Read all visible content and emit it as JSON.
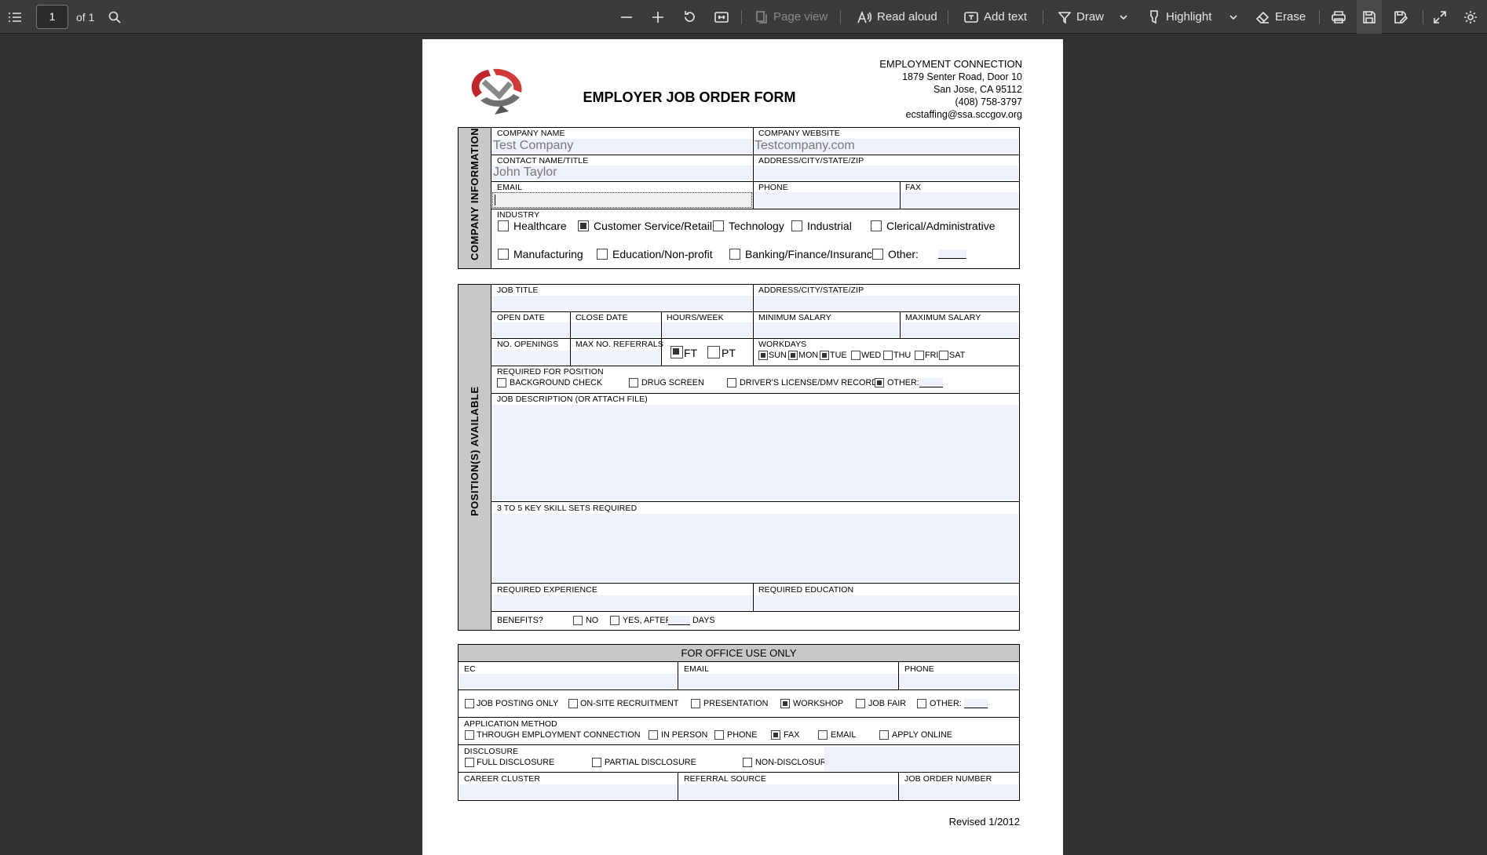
{
  "toolbar": {
    "page_current": "1",
    "page_total": "of 1",
    "page_view": "Page view",
    "read_aloud": "Read aloud",
    "add_text": "Add text",
    "draw": "Draw",
    "highlight": "Highlight",
    "erase": "Erase"
  },
  "form": {
    "org_name": "EMPLOYMENT CONNECTION",
    "org_address": "1879 Senter Road, Door 10",
    "org_city": "San Jose, CA 95112",
    "org_phone": "(408) 758-3797",
    "org_email": "ecstaffing@ssa.sccgov.org",
    "title": "EMPLOYER JOB ORDER FORM",
    "company_section": "COMPANY INFORMATION",
    "company_name_label": "COMPANY NAME",
    "company_name_value": "Test Company",
    "company_website_label": "COMPANY WEBSITE",
    "company_website_value": "Testcompany.com",
    "contact_label": "CONTACT NAME/TITLE",
    "contact_value": "John Taylor",
    "address_label": "ADDRESS/CITY/STATE/ZIP",
    "email_label": "EMAIL",
    "phone_label": "PHONE",
    "fax_label": "FAX",
    "industry_label": "INDUSTRY",
    "industry": [
      {
        "label": "Healthcare",
        "checked": false
      },
      {
        "label": "Customer Service/Retail",
        "checked": true
      },
      {
        "label": "Technology",
        "checked": false
      },
      {
        "label": "Industrial",
        "checked": false
      },
      {
        "label": "Clerical/Administrative",
        "checked": false
      },
      {
        "label": "Manufacturing",
        "checked": false
      },
      {
        "label": "Education/Non-profit",
        "checked": false
      },
      {
        "label": "Banking/Finance/Insurance",
        "checked": false
      },
      {
        "label": "Other:",
        "checked": false
      }
    ],
    "positions_section": "POSITION(S) AVAILABLE",
    "job_title_label": "JOB TITLE",
    "job_address_label": "ADDRESS/CITY/STATE/ZIP",
    "open_date_label": "OPEN DATE",
    "close_date_label": "CLOSE DATE",
    "hours_label": "HOURS/WEEK",
    "min_salary_label": "MINIMUM SALARY",
    "max_salary_label": "MAXIMUM SALARY",
    "openings_label": "NO. OPENINGS",
    "max_referrals_label": "MAX NO. REFERRALS",
    "ft": {
      "label": "FT",
      "checked": true
    },
    "pt": {
      "label": "PT",
      "checked": false
    },
    "workdays_label": "WORKDAYS",
    "workdays": [
      {
        "label": "SUN",
        "checked": true
      },
      {
        "label": "MON",
        "checked": true
      },
      {
        "label": "TUE",
        "checked": true
      },
      {
        "label": "WED",
        "checked": false
      },
      {
        "label": "THU",
        "checked": false
      },
      {
        "label": "FRI",
        "checked": false
      },
      {
        "label": "SAT",
        "checked": false
      }
    ],
    "required_label": "REQUIRED FOR POSITION",
    "required": [
      {
        "label": "BACKGROUND CHECK",
        "checked": false
      },
      {
        "label": "DRUG SCREEN",
        "checked": false
      },
      {
        "label": "DRIVER'S LICENSE/DMV RECORD",
        "checked": false
      },
      {
        "label": "OTHER:",
        "checked": true
      }
    ],
    "job_desc_label": "JOB DESCRIPTION (OR ATTACH FILE)",
    "skills_label": "3 TO 5 KEY SKILL SETS REQUIRED",
    "experience_label": "REQUIRED EXPERIENCE",
    "education_label": "REQUIRED EDUCATION",
    "benefits_label": "BENEFITS?",
    "benefits_no": "NO",
    "benefits_yes": "YES, AFTER",
    "benefits_days": "DAYS",
    "office_title": "FOR OFFICE USE ONLY",
    "ec_label": "EC",
    "office_email_label": "EMAIL",
    "office_phone_label": "PHONE",
    "office_opts": [
      {
        "label": "JOB POSTING ONLY",
        "checked": false
      },
      {
        "label": "ON-SITE RECRUITMENT",
        "checked": false
      },
      {
        "label": "PRESENTATION",
        "checked": false
      },
      {
        "label": "WORKSHOP",
        "checked": true
      },
      {
        "label": "JOB FAIR",
        "checked": false
      },
      {
        "label": "OTHER:",
        "checked": false
      }
    ],
    "app_method_label": "APPLICATION METHOD",
    "app_methods": [
      {
        "label": "THROUGH EMPLOYMENT CONNECTION",
        "checked": false
      },
      {
        "label": "IN PERSON",
        "checked": false
      },
      {
        "label": "PHONE",
        "checked": false
      },
      {
        "label": "FAX",
        "checked": true
      },
      {
        "label": "EMAIL",
        "checked": false
      },
      {
        "label": "APPLY ONLINE",
        "checked": false
      }
    ],
    "disclosure_label": "DISCLOSURE",
    "disclosures": [
      {
        "label": "FULL DISCLOSURE",
        "checked": false
      },
      {
        "label": "PARTIAL DISCLOSURE",
        "checked": false
      },
      {
        "label": "NON-DISCLOSURE",
        "checked": false
      }
    ],
    "career_label": "CAREER CLUSTER",
    "referral_label": "REFERRAL SOURCE",
    "job_order_label": "JOB ORDER NUMBER",
    "revised": "Revised 1/2012"
  }
}
